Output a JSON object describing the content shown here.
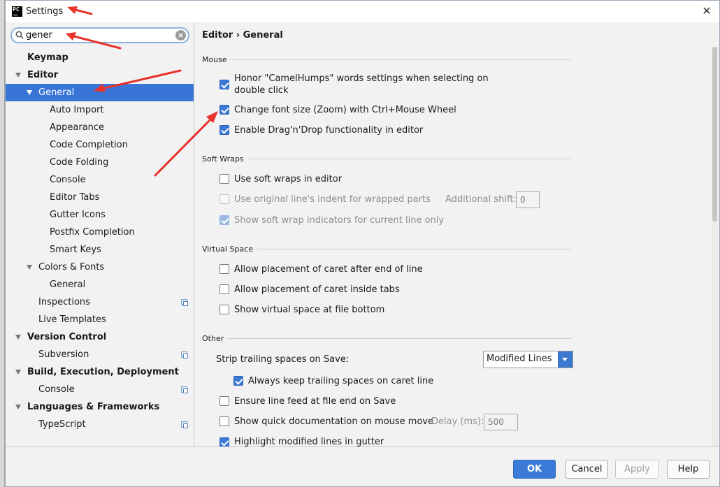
{
  "window": {
    "title": "Settings",
    "app_icon_text": "PC",
    "close_glyph": "✕"
  },
  "search": {
    "value": "gener",
    "placeholder": ""
  },
  "tree": {
    "items": [
      {
        "label": "Keymap"
      },
      {
        "label": "Editor"
      },
      {
        "label": "General"
      },
      {
        "label": "Auto Import"
      },
      {
        "label": "Appearance"
      },
      {
        "label": "Code Completion"
      },
      {
        "label": "Code Folding"
      },
      {
        "label": "Console"
      },
      {
        "label": "Editor Tabs"
      },
      {
        "label": "Gutter Icons"
      },
      {
        "label": "Postfix Completion"
      },
      {
        "label": "Smart Keys"
      },
      {
        "label": "Colors & Fonts"
      },
      {
        "label": "General"
      },
      {
        "label": "Inspections"
      },
      {
        "label": "Live Templates"
      },
      {
        "label": "Version Control"
      },
      {
        "label": "Subversion"
      },
      {
        "label": "Build, Execution, Deployment"
      },
      {
        "label": "Console"
      },
      {
        "label": "Languages & Frameworks"
      },
      {
        "label": "TypeScript"
      }
    ]
  },
  "content": {
    "breadcrumb": "Editor › General",
    "mouse": {
      "title": "Mouse",
      "camel_humps_line1": "Honor \"CamelHumps\" words settings when selecting on",
      "camel_humps_line2": "double click",
      "zoom": "Change font size (Zoom) with Ctrl+Mouse Wheel",
      "dragdrop": "Enable Drag'n'Drop functionality in editor"
    },
    "soft_wraps": {
      "title": "Soft Wraps",
      "use_soft_wraps": "Use soft wraps in editor",
      "original_indent": "Use original line's indent for wrapped parts",
      "additional_shift_label": "Additional shift:",
      "additional_shift_value": "0",
      "show_indicators": "Show soft wrap indicators for current line only"
    },
    "virtual_space": {
      "title": "Virtual Space",
      "after_end": "Allow placement of caret after end of line",
      "inside_tabs": "Allow placement of caret inside tabs",
      "file_bottom": "Show virtual space at file bottom"
    },
    "other": {
      "title": "Other",
      "strip_label": "Strip trailing spaces on Save:",
      "strip_value": "Modified Lines",
      "keep_trailing": "Always keep trailing spaces on caret line",
      "line_feed": "Ensure line feed at file end on Save",
      "quick_doc": "Show quick documentation on mouse move",
      "delay_label": "Delay (ms):",
      "delay_value": "500",
      "highlight_modified": "Highlight modified lines in gutter"
    }
  },
  "buttons": {
    "ok": "OK",
    "cancel": "Cancel",
    "apply": "Apply",
    "help": "Help"
  },
  "colors": {
    "selection": "#3875d7",
    "primary_button": "#3c7ad8",
    "annotation_arrow": "#e8322c"
  }
}
